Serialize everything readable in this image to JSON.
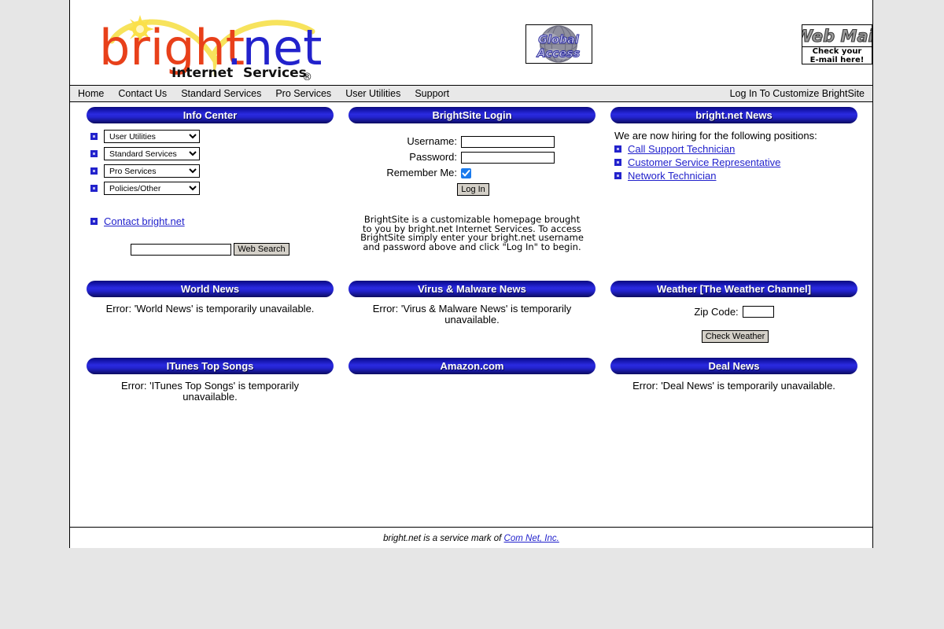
{
  "site": {
    "logo_primary": "bright",
    "logo_dot": ".",
    "logo_secondary": "net",
    "logo_tagline_left": "Internet",
    "logo_tagline_right": "Services",
    "logo_registered": "®"
  },
  "badges": {
    "global_access": {
      "line1": "Global",
      "line2": "Access",
      "icon": "globe-icon"
    },
    "web_mail": {
      "title": "Web Mail",
      "line1": "Check your",
      "line2": "E-mail here!"
    }
  },
  "nav": {
    "items": [
      {
        "label": "Home"
      },
      {
        "label": "Contact Us"
      },
      {
        "label": "Standard Services"
      },
      {
        "label": "Pro Services"
      },
      {
        "label": "User Utilities"
      },
      {
        "label": "Support"
      }
    ],
    "login_link": "Log In To Customize BrightSite"
  },
  "panels": {
    "info_center": {
      "title": "Info Center",
      "selects": [
        {
          "name": "user-utilities",
          "selected": "User Utilities"
        },
        {
          "name": "standard-services",
          "selected": "Standard Services"
        },
        {
          "name": "pro-services",
          "selected": "Pro Services"
        },
        {
          "name": "policies-other",
          "selected": "Policies/Other"
        }
      ],
      "contact_link": "Contact bright.net",
      "search_value": "",
      "search_placeholder": "",
      "search_button": "Web Search"
    },
    "brightsite_login": {
      "title": "BrightSite Login",
      "username_label": "Username:",
      "username_value": "",
      "password_label": "Password:",
      "password_value": "",
      "remember_label": "Remember Me:",
      "remember_checked": true,
      "login_button": "Log In",
      "blurb": [
        "BrightSite is a customizable homepage brought",
        "to you by bright.net Internet Services. To access",
        "BrightSite simply enter your bright.net username",
        "and password above and click \"Log In\" to begin."
      ]
    },
    "brightnet_news": {
      "title": "bright.net News",
      "intro": "We are now hiring for the following positions:",
      "links": [
        {
          "label": "Call Support Technician"
        },
        {
          "label": "Customer Service Representative"
        },
        {
          "label": "Network Technician"
        }
      ]
    },
    "world_news": {
      "title": "World News",
      "error": "Error: 'World News' is temporarily unavailable."
    },
    "virus_malware_news": {
      "title": "Virus & Malware News",
      "error": "Error: 'Virus & Malware News' is temporarily unavailable."
    },
    "weather": {
      "title": "Weather [The Weather Channel]",
      "zip_label": "Zip Code:",
      "zip_value": "",
      "check_button": "Check Weather"
    },
    "itunes_top_songs": {
      "title": "ITunes Top Songs",
      "error": "Error: 'ITunes Top Songs' is temporarily unavailable."
    },
    "amazon": {
      "title": "Amazon.com",
      "error": ""
    },
    "deal_news": {
      "title": "Deal News",
      "error": "Error: 'Deal News' is temporarily unavailable."
    }
  },
  "footer": {
    "text": "bright.net is a service mark of ",
    "link": "Com Net, Inc."
  },
  "colors": {
    "link": "#2222cc",
    "pill_blue": "#2a2ae0",
    "pill_dark": "#0d0d7a",
    "nav_bg": "#e8e8e8",
    "page_bg": "#e6e6e6",
    "logo_red": "#e8401a",
    "logo_blue": "#2222cc",
    "logo_yellow": "#f5e04a",
    "checkbox_blue": "#1a7aed"
  }
}
